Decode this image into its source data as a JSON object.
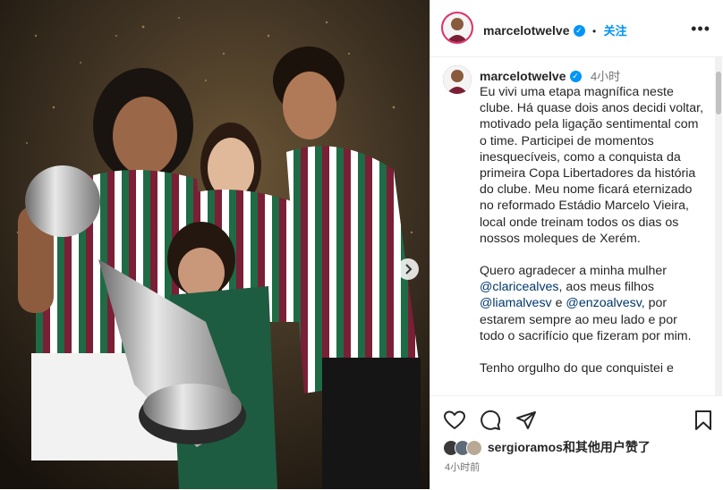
{
  "post": {
    "username": "marcelotwelve",
    "separator": "•",
    "follow_label": "关注",
    "more_icon": "more-horizontal-icon"
  },
  "caption": {
    "username": "marcelotwelve",
    "time": "4小时",
    "paragraph1": "Eu vivi uma etapa magnífica neste clube. Há quase dois anos decidi voltar, motivado pela ligação sentimental com o time. Participei de momentos inesquecíveis, como a conquista da primeira Copa Libertadores da história do clube. Meu nome ficará eternizado no reformado Estádio Marcelo Vieira, local onde treinam todos os dias os nossos moleques de Xerém.",
    "paragraph2_before": "Quero agradecer a minha mulher ",
    "mention1": "@claricealves",
    "paragraph2_mid": ", aos meus filhos ",
    "mention2": "@liamalvesv",
    "paragraph2_and": " e ",
    "mention3": "@enzoalvesv",
    "paragraph2_after": ", por estarem sempre ao meu lado e por todo o sacrifício que fizeram por mim.",
    "paragraph3_partial": "Tenho orgulho do que conquistei e"
  },
  "actions": {
    "like_icon": "heart-icon",
    "comment_icon": "comment-icon",
    "share_icon": "send-icon",
    "save_icon": "bookmark-icon"
  },
  "likes": {
    "liker": "sergioramos",
    "suffix": "和其他用户赞了"
  },
  "timestamp": "4小时前",
  "colors": {
    "link_blue": "#0095f6",
    "mention_blue": "#00376b",
    "text": "#262626",
    "muted": "#737373"
  }
}
